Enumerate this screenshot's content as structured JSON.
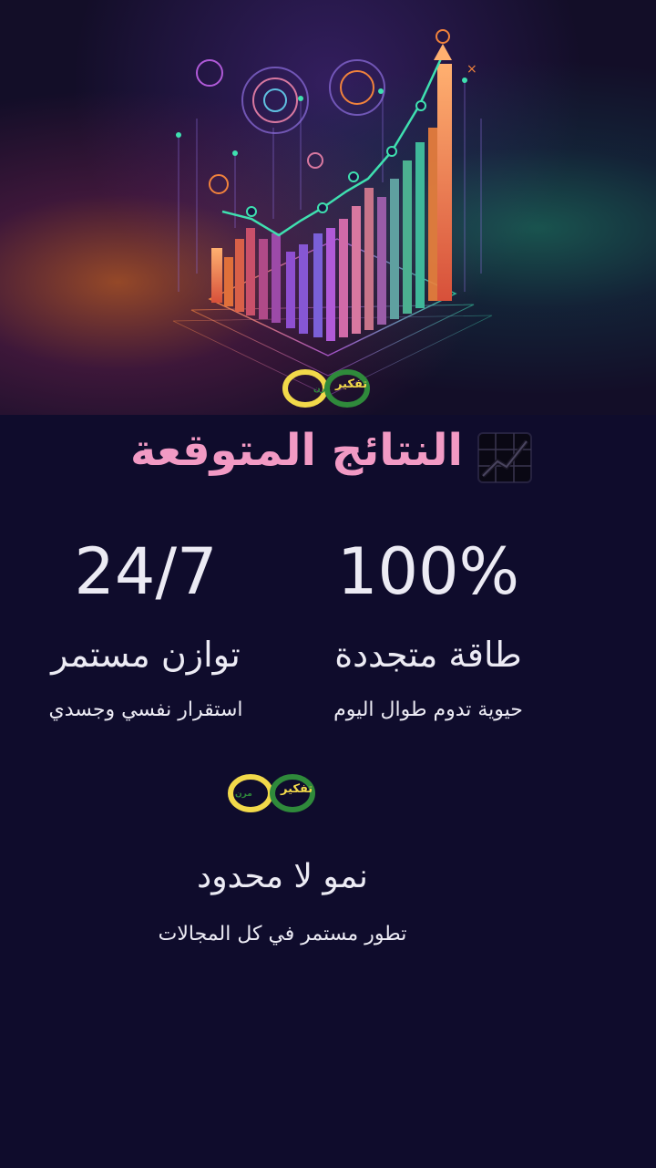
{
  "brand": {
    "name": "تفكير",
    "tagline": "مرن",
    "colors": {
      "yellow": "#f2d94a",
      "green": "#2f8a3b"
    }
  },
  "hero": {
    "icon": "growth-chart-illustration"
  },
  "section": {
    "title": "النتائج المتوقعة",
    "title_icon": "chart-increasing-icon",
    "title_color": "#f29ac4"
  },
  "stats": [
    {
      "value": "100%",
      "label": "طاقة متجددة",
      "description": "حيوية تدوم طوال اليوم"
    },
    {
      "value": "24/7",
      "label": "توازن مستمر",
      "description": "استقرار نفسي وجسدي"
    }
  ],
  "growth": {
    "title": "نمو لا محدود",
    "description": "تطور مستمر في كل المجالات"
  },
  "background": "#0f0c2c"
}
